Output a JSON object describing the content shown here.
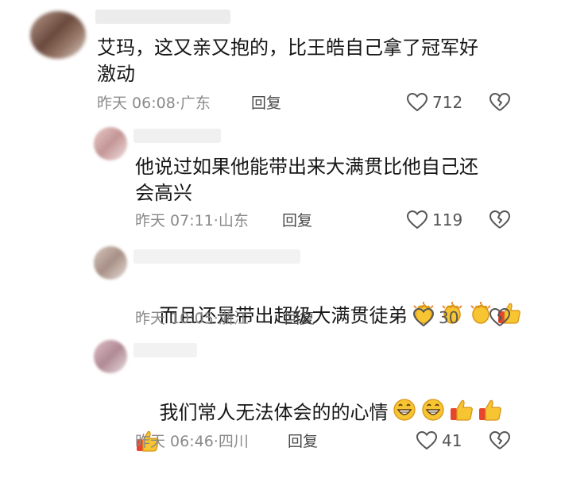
{
  "comments": [
    {
      "text": "艾玛，这又亲又抱的，比王皓自己拿了冠军好\n激动",
      "time": "昨天 06:08",
      "location": "广东",
      "reply_label": "回复",
      "likes": "712",
      "emojis": []
    },
    {
      "text": "他说过如果他能带出来大满贯比他自己还\n会高兴",
      "time": "昨天 07:11",
      "location": "山东",
      "reply_label": "回复",
      "likes": "119",
      "emojis": []
    },
    {
      "text": "而且还是带出超级大满贯徒弟",
      "time": "昨天 10:05",
      "location": "浙江",
      "reply_label": "回复",
      "likes": "30",
      "emojis": [
        "clapping-hands",
        "clapping-hands",
        "clapping-hands",
        "thumbs-up"
      ]
    },
    {
      "text": "我们常人无法体会的的心情",
      "time": "昨天 06:46",
      "location": "四川",
      "reply_label": "回复",
      "likes": "41",
      "emojis": [
        "grinning-face",
        "grinning-face",
        "thumbs-up",
        "thumbs-up",
        "thumbs-up"
      ]
    }
  ],
  "meta_separator": "·"
}
